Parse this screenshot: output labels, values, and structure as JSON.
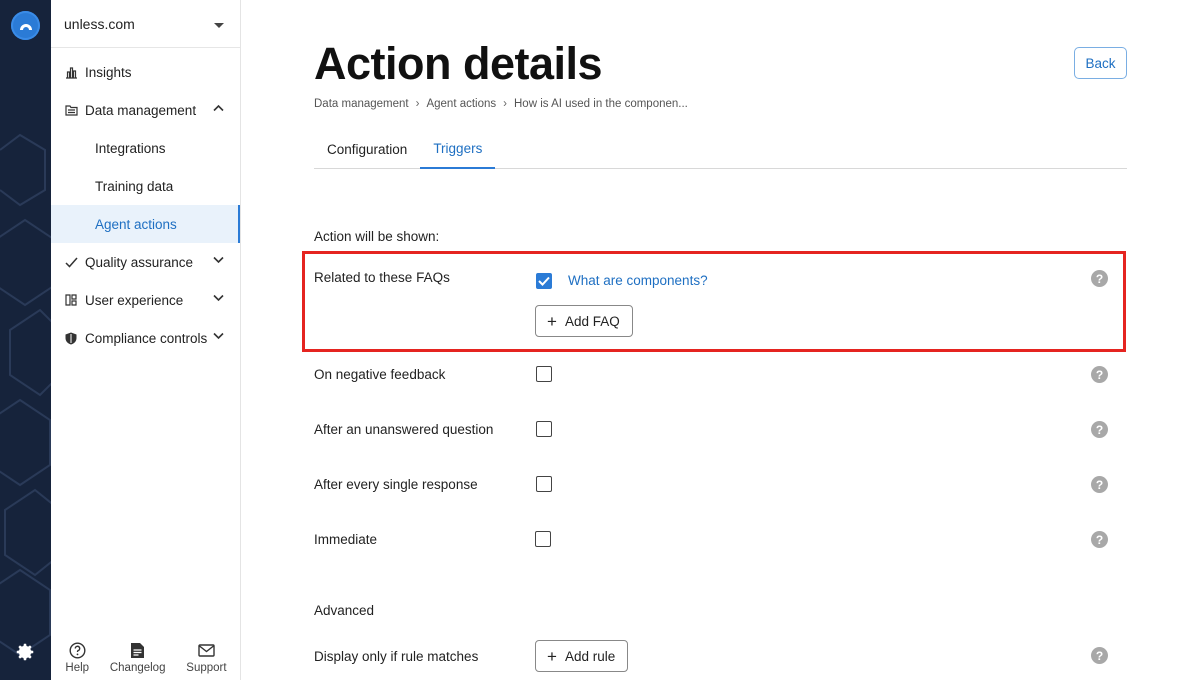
{
  "org": {
    "name": "unless.com"
  },
  "nav": {
    "insights": "Insights",
    "data_management": "Data management",
    "sub": [
      "Integrations",
      "Training data",
      "Agent actions"
    ],
    "quality_assurance": "Quality assurance",
    "user_experience": "User experience",
    "compliance_controls": "Compliance controls"
  },
  "footer": {
    "help": "Help",
    "changelog": "Changelog",
    "support": "Support"
  },
  "page": {
    "title": "Action details",
    "back": "Back",
    "breadcrumb": [
      "Data management",
      "Agent actions",
      "How is AI used in the componen..."
    ],
    "tabs": [
      "Configuration",
      "Triggers"
    ],
    "active_tab": "Triggers"
  },
  "triggers": {
    "shown_label": "Action will be shown:",
    "related_faqs": {
      "label": "Related to these FAQs",
      "checked": true,
      "faq": "What are components?",
      "add_button": "Add FAQ"
    },
    "options": [
      {
        "label": "On negative feedback",
        "checked": false
      },
      {
        "label": "After an unanswered question",
        "checked": false
      },
      {
        "label": "After every single response",
        "checked": false
      },
      {
        "label": "Immediate",
        "checked": false
      }
    ],
    "advanced_label": "Advanced",
    "rule_label": "Display only if rule matches",
    "add_rule_button": "Add rule",
    "help_glyph": "?"
  },
  "colors": {
    "accent": "#2b7bd6",
    "highlight": "#e52420",
    "rail": "#16233b"
  }
}
